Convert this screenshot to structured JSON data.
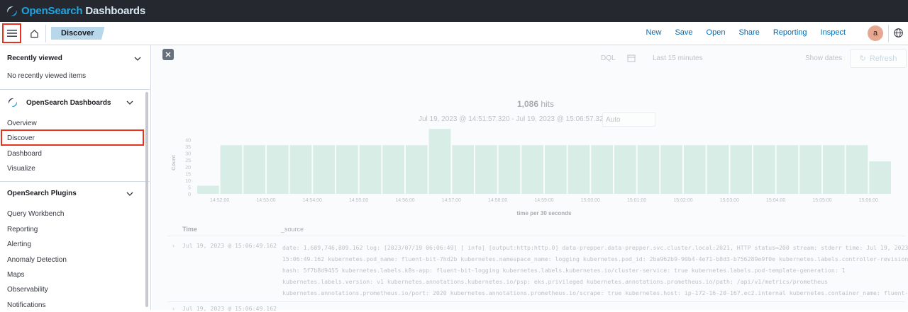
{
  "brand": {
    "part1": "OpenSearch",
    "part2": " Dashboards"
  },
  "header": {
    "breadcrumb": "Discover",
    "actions": [
      "New",
      "Save",
      "Open",
      "Share",
      "Reporting",
      "Inspect"
    ],
    "avatar_letter": "a"
  },
  "sidebar": {
    "recent_title": "Recently viewed",
    "recent_empty": "No recently viewed items",
    "dash_title": "OpenSearch Dashboards",
    "dash_items": [
      "Overview",
      "Discover",
      "Dashboard",
      "Visualize"
    ],
    "plugins_title": "OpenSearch Plugins",
    "plugin_items": [
      "Query Workbench",
      "Reporting",
      "Alerting",
      "Anomaly Detection",
      "Maps",
      "Observability",
      "Notifications"
    ]
  },
  "query": {
    "dql": "DQL",
    "time": "Last 15 minutes",
    "show_dates": "Show dates",
    "refresh": "Refresh"
  },
  "summary": {
    "hits_count": "1,086",
    "hits_label": " hits",
    "range": "Jul 19, 2023 @ 14:51:57.320 - Jul 19, 2023 @ 15:06:57.320",
    "interval": "Auto"
  },
  "chart_data": {
    "type": "bar",
    "ylabel": "Count",
    "xlabel": "time per 30 seconds",
    "y_ticks": [
      0,
      5,
      10,
      15,
      20,
      25,
      30,
      35,
      40
    ],
    "x_ticks": [
      "14:52:00",
      "14:53:00",
      "14:54:00",
      "14:55:00",
      "14:56:00",
      "14:57:00",
      "14:58:00",
      "14:59:00",
      "15:00:00",
      "15:01:00",
      "15:02:00",
      "15:03:00",
      "15:04:00",
      "15:05:00",
      "15:06:00"
    ],
    "values": [
      6,
      36,
      36,
      36,
      36,
      36,
      36,
      36,
      36,
      36,
      48,
      36,
      36,
      36,
      36,
      36,
      36,
      36,
      36,
      36,
      36,
      36,
      36,
      36,
      36,
      36,
      36,
      36,
      36,
      24
    ],
    "ylim": [
      0,
      45
    ]
  },
  "table": {
    "col_time": "Time",
    "col_source": "_source",
    "rows": [
      {
        "time": "Jul 19, 2023 @ 15:06:49.162",
        "lines": [
          "date: 1,689,746,809.162  log: [2023/07/19 06:06:49] [ info] [output:http:http.0] data-prepper.data-prepper.svc.cluster.local:2021, HTTP status=200  stream: stderr  time: Jul 19, 2023 @",
          "15:06:49.162  kubernetes.pod_name: fluent-bit-7hd2b  kubernetes.namespace_name: logging  kubernetes.pod_id: 2ba962b9-90b4-4e71-b8d3-b756289e9f0e  kubernetes.labels.controller-revision-",
          "hash: 5f7b8d9455  kubernetes.labels.k8s-app: fluent-bit-logging  kubernetes.labels.kubernetes.io/cluster-service: true  kubernetes.labels.pod-template-generation: 1",
          "kubernetes.labels.version: v1  kubernetes.annotations.kubernetes.io/psp: eks.privileged  kubernetes.annotations.prometheus.io/path: /api/v1/metrics/prometheus",
          "kubernetes.annotations.prometheus.io/port: 2020  kubernetes.annotations.prometheus.io/scrape: true  kubernetes.host: ip-172-16-20-167.ec2.internal  kubernetes.container_name: fluent-"
        ]
      },
      {
        "time": "Jul 19, 2023 @ 15:06:49.162",
        "lines": []
      }
    ]
  }
}
